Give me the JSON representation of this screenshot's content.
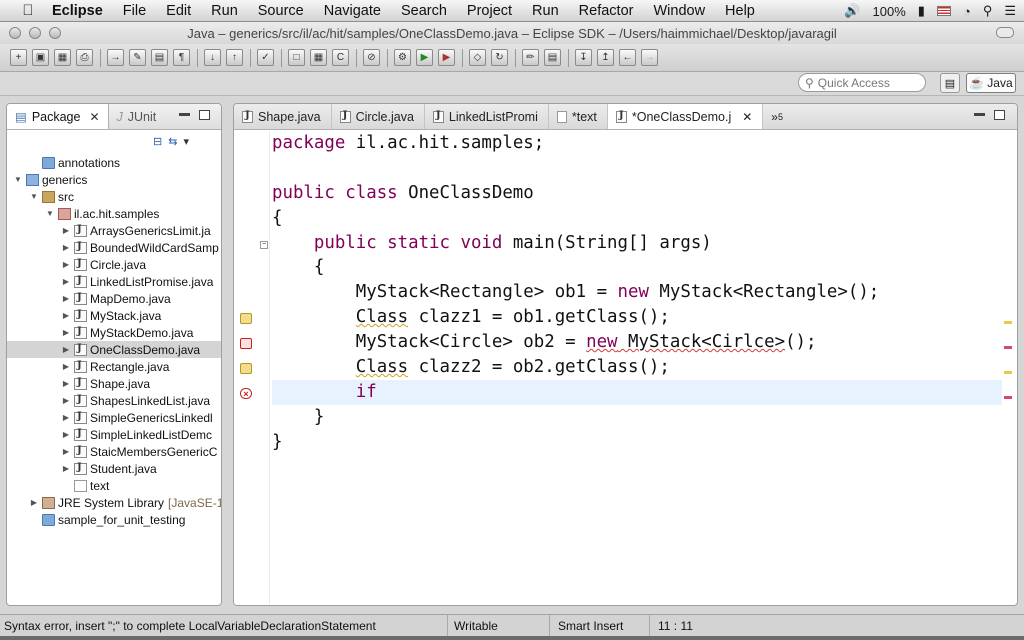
{
  "menubar": {
    "app": "Eclipse",
    "items": [
      "File",
      "Edit",
      "Run",
      "Source",
      "Navigate",
      "Search",
      "Project",
      "Run",
      "Refactor",
      "Window",
      "Help"
    ],
    "battery": "100%",
    "icons": [
      "apple-icon",
      "volume-icon",
      "battery-icon",
      "flag-icon",
      "clock-icon",
      "spotlight-icon",
      "list-icon"
    ]
  },
  "window": {
    "title": "Java – generics/src/il/ac/hit/samples/OneClassDemo.java – Eclipse SDK – /Users/haimmichael/Desktop/javaragil"
  },
  "perspective": {
    "quick_access_placeholder": "Quick Access",
    "active": "Java"
  },
  "left_view": {
    "tabs": [
      {
        "label": "Package",
        "active": true
      },
      {
        "label": "JUnit",
        "active": false
      }
    ],
    "tree": [
      {
        "label": "annotations",
        "icon": "folder",
        "level": 1,
        "twisty": ""
      },
      {
        "label": "generics",
        "icon": "project",
        "level": 0,
        "twisty": "▼"
      },
      {
        "label": "src",
        "icon": "src",
        "level": 1,
        "twisty": "▼"
      },
      {
        "label": "il.ac.hit.samples",
        "icon": "package",
        "level": 2,
        "twisty": "▼"
      },
      {
        "label": "ArraysGenericsLimit.ja",
        "icon": "java",
        "level": 3,
        "twisty": "▶"
      },
      {
        "label": "BoundedWildCardSamp",
        "icon": "java",
        "level": 3,
        "twisty": "▶"
      },
      {
        "label": "Circle.java",
        "icon": "java",
        "level": 3,
        "twisty": "▶"
      },
      {
        "label": "LinkedListPromise.java",
        "icon": "java",
        "level": 3,
        "twisty": "▶"
      },
      {
        "label": "MapDemo.java",
        "icon": "java",
        "level": 3,
        "twisty": "▶"
      },
      {
        "label": "MyStack.java",
        "icon": "java",
        "level": 3,
        "twisty": "▶"
      },
      {
        "label": "MyStackDemo.java",
        "icon": "java",
        "level": 3,
        "twisty": "▶"
      },
      {
        "label": "OneClassDemo.java",
        "icon": "java",
        "level": 3,
        "twisty": "▶",
        "selected": true
      },
      {
        "label": "Rectangle.java",
        "icon": "java",
        "level": 3,
        "twisty": "▶"
      },
      {
        "label": "Shape.java",
        "icon": "java",
        "level": 3,
        "twisty": "▶"
      },
      {
        "label": "ShapesLinkedList.java",
        "icon": "java",
        "level": 3,
        "twisty": "▶"
      },
      {
        "label": "SimpleGenericsLinkedl",
        "icon": "java",
        "level": 3,
        "twisty": "▶"
      },
      {
        "label": "SimpleLinkedListDemc",
        "icon": "java",
        "level": 3,
        "twisty": "▶"
      },
      {
        "label": "StaicMembersGenericC",
        "icon": "java",
        "level": 3,
        "twisty": "▶"
      },
      {
        "label": "Student.java",
        "icon": "java",
        "level": 3,
        "twisty": "▶"
      },
      {
        "label": "text",
        "icon": "file",
        "level": 3,
        "twisty": ""
      },
      {
        "label": "JRE System Library",
        "decoration": "[JavaSE-1",
        "icon": "library",
        "level": 1,
        "twisty": "▶"
      },
      {
        "label": "sample_for_unit_testing",
        "icon": "folder",
        "level": 1,
        "twisty": ""
      }
    ]
  },
  "editor": {
    "tabs": [
      {
        "label": "Shape.java",
        "icon": "java",
        "active": false
      },
      {
        "label": "Circle.java",
        "icon": "java",
        "active": false
      },
      {
        "label": "LinkedListPromi",
        "icon": "java",
        "active": false
      },
      {
        "label": "*text",
        "icon": "file",
        "active": false
      },
      {
        "label": "*OneClassDemo.j",
        "icon": "java",
        "active": true
      }
    ],
    "overflow_label": "»",
    "overflow_count": "5",
    "code_lines": [
      [
        {
          "k": "kw",
          "t": "package"
        },
        {
          "k": "t",
          "t": " il.ac.hit.samples;"
        }
      ],
      [],
      [
        {
          "k": "kw",
          "t": "public class"
        },
        {
          "k": "t",
          "t": " OneClassDemo"
        }
      ],
      [
        {
          "k": "t",
          "t": "{"
        }
      ],
      [
        {
          "k": "t",
          "t": "    "
        },
        {
          "k": "kw",
          "t": "public static void"
        },
        {
          "k": "t",
          "t": " main(String[] args)"
        }
      ],
      [
        {
          "k": "t",
          "t": "    {"
        }
      ],
      [
        {
          "k": "t",
          "t": "        MyStack<Rectangle> ob1 = "
        },
        {
          "k": "kw",
          "t": "new"
        },
        {
          "k": "t",
          "t": " MyStack<Rectangle>();"
        }
      ],
      [
        {
          "k": "t",
          "t": "        "
        },
        {
          "k": "t wsquig",
          "t": "Class"
        },
        {
          "k": "t",
          "t": " clazz1 = ob1.getClass();"
        }
      ],
      [
        {
          "k": "t",
          "t": "        MyStack<Circle> ob2 = "
        },
        {
          "k": "kw squig",
          "t": "new"
        },
        {
          "k": "t squig",
          "t": " MyStack<Cirlce>"
        },
        {
          "k": "t",
          "t": "();"
        }
      ],
      [
        {
          "k": "t",
          "t": "        "
        },
        {
          "k": "t wsquig",
          "t": "Class"
        },
        {
          "k": "t",
          "t": " clazz2 = ob2.getClass();"
        }
      ],
      [
        {
          "k": "t",
          "t": "        "
        },
        {
          "k": "kw",
          "t": "if"
        }
      ],
      [
        {
          "k": "t",
          "t": "    }"
        }
      ],
      [
        {
          "k": "t",
          "t": "}"
        }
      ]
    ],
    "current_line": 10
  },
  "status": {
    "message": "Syntax error, insert \";\" to complete LocalVariableDeclarationStatement",
    "mode": "Writable",
    "insert_mode": "Smart Insert",
    "position": "11 : 11"
  }
}
